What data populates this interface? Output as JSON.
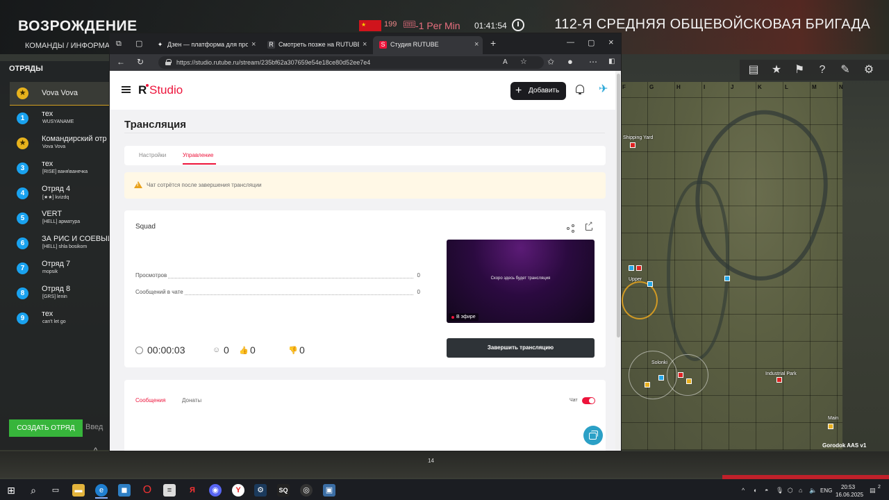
{
  "game": {
    "faction_title": "ВОЗРОЖДЕНИЕ",
    "subtitle": "КОМАНДЫ / ИНФОРМА",
    "tickets": "199",
    "per_min": "-1 Per Min",
    "match_time": "01:41:54",
    "enemy_title": "112-Я СРЕДНЯЯ ОБЩЕВОЙСКОВАЯ БРИГАДА",
    "squads_title": "ОТРЯДЫ",
    "my_squad": {
      "name": "Vova Vova"
    },
    "squads": [
      {
        "num": "1",
        "name": "тех",
        "lead": "WUSYANAME",
        "star": false
      },
      {
        "num": "★",
        "name": "Командирский отр",
        "lead": "Vova Vova",
        "star": true
      },
      {
        "num": "3",
        "name": "тех",
        "lead": "[RISE] ваня\\ванечка",
        "star": false
      },
      {
        "num": "4",
        "name": "Отряд 4",
        "lead": "[★★] kvizdq",
        "star": false
      },
      {
        "num": "5",
        "name": "VERT",
        "lead": "[HELL] арматура",
        "star": false
      },
      {
        "num": "6",
        "name": "ЗА РИС И СОЕВЫЙ",
        "lead": "[HELL] shla bosikom",
        "star": false
      },
      {
        "num": "7",
        "name": "Отряд 7",
        "lead": "mopsik",
        "star": false
      },
      {
        "num": "8",
        "name": "Отряд 8",
        "lead": "[GRS] lenin",
        "star": false
      },
      {
        "num": "9",
        "name": "тех",
        "lead": "can't let go",
        "star": false
      }
    ],
    "create_squad_label": "СОЗДАТЬ ОТРЯД",
    "create_input_placeholder": "Введ",
    "map_letters": [
      "F",
      "G",
      "H",
      "I",
      "J",
      "K",
      "L",
      "M",
      "N"
    ],
    "map_labels": {
      "shipping_yard": "Shipping Yard",
      "upper": "Upper",
      "solonki": "Solonki",
      "industrial_park": "Industrial Park",
      "main": "Main"
    },
    "map_name": "Gorodok AAS v1",
    "bottom_number": "14"
  },
  "browser": {
    "tabs": [
      {
        "title": "Дзен — платформа для просмотра",
        "favicon": "✦",
        "fav_color": "#222222"
      },
      {
        "title": "Смотреть позже на RUTUBE",
        "favicon": "R",
        "fav_color": "#3a3b3f"
      },
      {
        "title": "Студия RUTUBE",
        "favicon": "S",
        "fav_color": "#ed143b"
      }
    ],
    "new_tab": "+",
    "url": "https://studio.rutube.ru/stream/235bf62a307659e54e18ce80d52ee7e4"
  },
  "studio": {
    "logo_r": "R",
    "logo_studio": "Studio",
    "add_label": "Добавить",
    "page_title": "Трансляция",
    "tabs": {
      "settings": "Настройки",
      "control": "Управление"
    },
    "notice": "Чат сотрётся после завершения трансляции",
    "stream_name": "Squad",
    "stats": [
      {
        "label": "Просмотров",
        "value": "0"
      },
      {
        "label": "Сообщений в чате",
        "value": "0"
      }
    ],
    "preview_text": "Скоро здесь будет трансляция",
    "live_label": "В эфире",
    "timer": "00:00:03",
    "viewers": "0",
    "likes": "0",
    "dislikes": "0",
    "end_label": "Завершить трансляцию",
    "chat_tabs": {
      "messages": "Сообщения",
      "donats": "Донаты"
    },
    "chat_toggle_label": "Чат"
  },
  "taskbar": {
    "lang": "ENG",
    "time": "20:53",
    "date": "16.06.2025",
    "notifications": "2"
  },
  "colors": {
    "accent": "#ed143b",
    "dark_button": "#1b1b1f",
    "squad_blue": "#19a2ef",
    "squad_gold": "#e7b21c"
  }
}
